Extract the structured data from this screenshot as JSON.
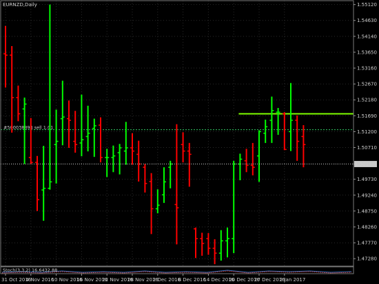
{
  "window": {
    "title": "EURNZD,Daily",
    "indicator_label": "Stoch(3,3,2) 16.6432.88",
    "order_label": "#500038894 sell 1.01"
  },
  "colors": {
    "background": "#000000",
    "bull": "#00ff00",
    "bear": "#ff0000",
    "grid": "#2a2a2a",
    "level": "#7fff00",
    "order_line": "#33cc66",
    "price_tag_bg": "#c8c8c8"
  },
  "chart_data": {
    "type": "ohlc",
    "symbol": "EURNZD",
    "timeframe": "Daily",
    "y_range": [
      1.4705,
      1.5524
    ],
    "y_ticks": [
      "1.55120",
      "1.54630",
      "1.54140",
      "1.53650",
      "1.53160",
      "1.52670",
      "1.52180",
      "1.51690",
      "1.51200",
      "1.50710",
      "1.50200",
      "1.49730",
      "1.49240",
      "1.48750",
      "1.48260",
      "1.47770",
      "1.47280"
    ],
    "y_tick_values": [
      1.5512,
      1.5463,
      1.5414,
      1.5365,
      1.5316,
      1.5267,
      1.5218,
      1.5169,
      1.512,
      1.5071,
      1.502,
      1.4973,
      1.4924,
      1.4875,
      1.4826,
      1.4777,
      1.4728
    ],
    "current_price": "1.50199",
    "current_price_value": 1.502,
    "resistance_level": 1.5175,
    "order_price": 1.5126,
    "x_ticks": [
      "31 Oct 2016",
      "4 Nov 2016",
      "10 Nov 2016",
      "16 Nov 2016",
      "22 Nov 2016",
      "28 Nov 2016",
      "2 Dec 2016",
      "8 Dec 2016",
      "14 Dec 2016",
      "20 Dec 2016",
      "27 Dec 2016",
      "2 Jan 2017"
    ],
    "x_tick_bar_index": [
      0,
      4,
      8,
      12,
      16,
      20,
      24,
      28,
      32,
      36,
      40,
      44
    ],
    "bars": [
      {
        "o": 1.536,
        "h": 1.5446,
        "l": 1.5256,
        "c": 1.5356
      },
      {
        "o": 1.5356,
        "h": 1.5384,
        "l": 1.5117,
        "c": 1.5225
      },
      {
        "o": 1.5225,
        "h": 1.5262,
        "l": 1.5152,
        "c": 1.5175
      },
      {
        "o": 1.519,
        "h": 1.5225,
        "l": 1.502,
        "c": 1.5205
      },
      {
        "o": 1.504,
        "h": 1.5162,
        "l": 1.502,
        "c": 1.5025
      },
      {
        "o": 1.5025,
        "h": 1.5045,
        "l": 1.4875,
        "c": 1.491
      },
      {
        "o": 1.494,
        "h": 1.5076,
        "l": 1.4845,
        "c": 1.4945
      },
      {
        "o": 1.4945,
        "h": 1.5512,
        "l": 1.4941,
        "c": 1.4965
      },
      {
        "o": 1.508,
        "h": 1.5188,
        "l": 1.496,
        "c": 1.509
      },
      {
        "o": 1.516,
        "h": 1.5277,
        "l": 1.5078,
        "c": 1.5165
      },
      {
        "o": 1.516,
        "h": 1.5216,
        "l": 1.507,
        "c": 1.5155
      },
      {
        "o": 1.509,
        "h": 1.5184,
        "l": 1.5055,
        "c": 1.508
      },
      {
        "o": 1.5085,
        "h": 1.5234,
        "l": 1.5044,
        "c": 1.5095
      },
      {
        "o": 1.5105,
        "h": 1.52,
        "l": 1.5059,
        "c": 1.5115
      },
      {
        "o": 1.513,
        "h": 1.516,
        "l": 1.5042,
        "c": 1.5138
      },
      {
        "o": 1.514,
        "h": 1.5164,
        "l": 1.5025,
        "c": 1.504
      },
      {
        "o": 1.504,
        "h": 1.5067,
        "l": 1.498,
        "c": 1.504
      },
      {
        "o": 1.504,
        "h": 1.5077,
        "l": 1.4995,
        "c": 1.5045
      },
      {
        "o": 1.5055,
        "h": 1.5082,
        "l": 1.4988,
        "c": 1.507
      },
      {
        "o": 1.506,
        "h": 1.515,
        "l": 1.5018,
        "c": 1.507
      },
      {
        "o": 1.507,
        "h": 1.5115,
        "l": 1.5018,
        "c": 1.506
      },
      {
        "o": 1.505,
        "h": 1.5092,
        "l": 1.4966,
        "c": 1.502
      },
      {
        "o": 1.501,
        "h": 1.502,
        "l": 1.4932,
        "c": 1.496
      },
      {
        "o": 1.4966,
        "h": 1.4992,
        "l": 1.4804,
        "c": 1.4882
      },
      {
        "o": 1.4882,
        "h": 1.4942,
        "l": 1.4868,
        "c": 1.4893
      },
      {
        "o": 1.4925,
        "h": 1.501,
        "l": 1.49,
        "c": 1.4965
      },
      {
        "o": 1.501,
        "h": 1.503,
        "l": 1.4945,
        "c": 1.502
      },
      {
        "o": 1.4895,
        "h": 1.5143,
        "l": 1.4772,
        "c": 1.4885
      },
      {
        "o": 1.508,
        "h": 1.5118,
        "l": 1.5025,
        "c": 1.506
      },
      {
        "o": 1.506,
        "h": 1.5085,
        "l": 1.495,
        "c": 1.505
      },
      {
        "o": 1.482,
        "h": 1.4824,
        "l": 1.473,
        "c": 1.479
      },
      {
        "o": 1.479,
        "h": 1.4808,
        "l": 1.4737,
        "c": 1.4775
      },
      {
        "o": 1.479,
        "h": 1.4807,
        "l": 1.474,
        "c": 1.476
      },
      {
        "o": 1.476,
        "h": 1.4788,
        "l": 1.4711,
        "c": 1.4745
      },
      {
        "o": 1.4745,
        "h": 1.4816,
        "l": 1.4722,
        "c": 1.4783
      },
      {
        "o": 1.4783,
        "h": 1.4824,
        "l": 1.4732,
        "c": 1.479
      },
      {
        "o": 1.479,
        "h": 1.503,
        "l": 1.4745,
        "c": 1.502
      },
      {
        "o": 1.502,
        "h": 1.5052,
        "l": 1.497,
        "c": 1.5035
      },
      {
        "o": 1.503,
        "h": 1.5067,
        "l": 1.4995,
        "c": 1.5016
      },
      {
        "o": 1.5016,
        "h": 1.5085,
        "l": 1.4985,
        "c": 1.501
      },
      {
        "o": 1.5045,
        "h": 1.5124,
        "l": 1.4965,
        "c": 1.512
      },
      {
        "o": 1.5115,
        "h": 1.5157,
        "l": 1.5085,
        "c": 1.5135
      },
      {
        "o": 1.5155,
        "h": 1.5228,
        "l": 1.5085,
        "c": 1.5185
      },
      {
        "o": 1.518,
        "h": 1.5193,
        "l": 1.511,
        "c": 1.518
      },
      {
        "o": 1.5175,
        "h": 1.518,
        "l": 1.5063,
        "c": 1.5065
      },
      {
        "o": 1.512,
        "h": 1.527,
        "l": 1.506,
        "c": 1.5155
      },
      {
        "o": 1.5155,
        "h": 1.517,
        "l": 1.503,
        "c": 1.509
      },
      {
        "o": 1.5105,
        "h": 1.514,
        "l": 1.501,
        "c": 1.508
      }
    ]
  }
}
